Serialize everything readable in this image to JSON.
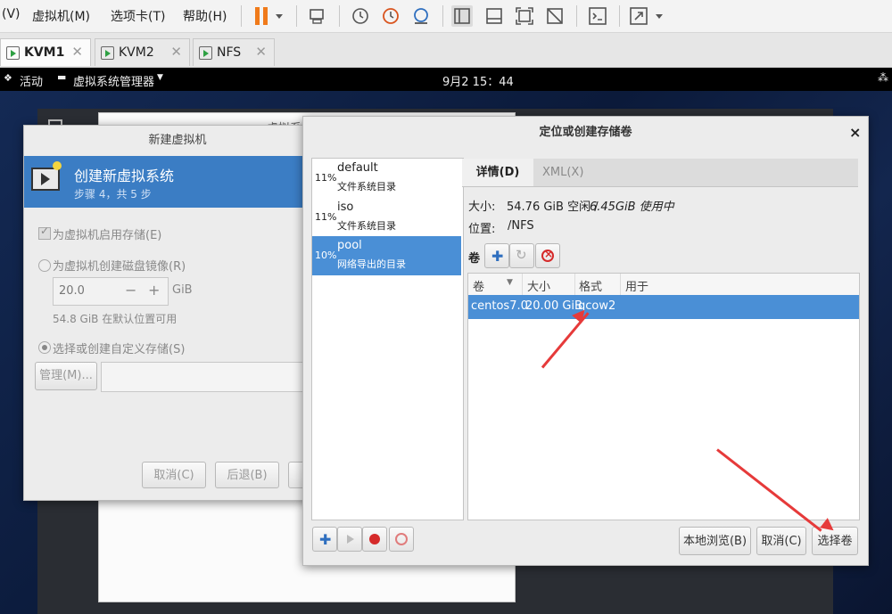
{
  "menubar": {
    "items": [
      "(V)",
      "虚拟机(M)",
      "选项卡(T)",
      "帮助(H)"
    ]
  },
  "tabs": [
    {
      "label": "KVM1",
      "active": true
    },
    {
      "label": "KVM2",
      "active": false
    },
    {
      "label": "NFS",
      "active": false
    }
  ],
  "gnome": {
    "activities": "活动",
    "app_menu": "虚拟系统管理器",
    "clock": "9月2 15：44"
  },
  "bg_window": {
    "title_fragment": "虚拟系"
  },
  "new_vm": {
    "title": "新建虚拟机",
    "heading": "创建新虚拟系统",
    "step": "步骤 4，共 5 步",
    "enable_storage": "为虚拟机启用存储(E)",
    "create_disk": "为虚拟机创建磁盘镜像(R)",
    "size_value": "20.0",
    "size_unit": "GiB",
    "available": "54.8 GiB 在默认位置可用",
    "select_custom": "选择或创建自定义存储(S)",
    "manage_button": "管理(M)...",
    "cancel_button": "取消(C)",
    "back_button": "后退(B)"
  },
  "storage_dialog": {
    "title": "定位或创建存储卷",
    "close": "×",
    "pools": [
      {
        "percent": "11%",
        "name": "default",
        "desc": "文件系统目录"
      },
      {
        "percent": "11%",
        "name": "iso",
        "desc": "文件系统目录"
      },
      {
        "percent": "10%",
        "name": "pool",
        "desc": "网络导出的目录"
      }
    ],
    "tabs": {
      "details": "详情(D)",
      "xml": "XML(X)"
    },
    "size_label": "大小:",
    "size_free": "54.76 GiB 空闲 /",
    "size_used": "6.45GiB 使用中",
    "location_label": "位置:",
    "location_value": "/NFS",
    "volumes_label": "卷",
    "columns": [
      "卷",
      "大小",
      "格式",
      "用于"
    ],
    "volumes": [
      {
        "name": "centos7.0",
        "size": "20.00 GiB",
        "format": "qcow2",
        "used_by": ""
      }
    ],
    "browse_button": "本地浏览(B)",
    "cancel_button": "取消(C)",
    "choose_button": "选择卷"
  },
  "colors": {
    "selection": "#4a8fd6",
    "wizard_header": "#3b7dc4",
    "annotation_arrow": "#e63a3a"
  }
}
